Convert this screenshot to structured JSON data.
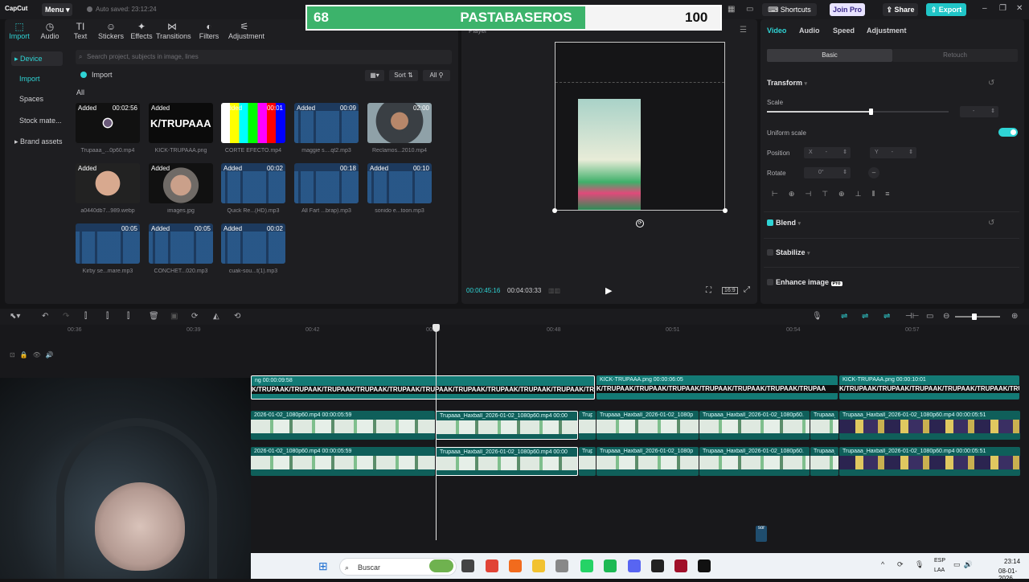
{
  "app": {
    "logo": "CapCut",
    "menu_label": "Menu",
    "autosave": "Auto saved: 23:12:24"
  },
  "topbar": {
    "shortcuts": "Shortcuts",
    "join_pro": "Join Pro",
    "share": "Share",
    "export": "Export"
  },
  "scoreboard": {
    "left_score": "68",
    "title": "PASTABASEROS",
    "right_score": "100"
  },
  "toolbar_tabs": [
    {
      "label": "Import",
      "icon": "import-icon"
    },
    {
      "label": "Audio",
      "icon": "audio-icon"
    },
    {
      "label": "Text",
      "icon": "text-icon"
    },
    {
      "label": "Stickers",
      "icon": "stickers-icon"
    },
    {
      "label": "Effects",
      "icon": "effects-icon"
    },
    {
      "label": "Transitions",
      "icon": "transitions-icon"
    },
    {
      "label": "Filters",
      "icon": "filters-icon"
    },
    {
      "label": "Adjustment",
      "icon": "adjustment-icon"
    }
  ],
  "sidebar": {
    "items": [
      "Device",
      "Import",
      "Spaces",
      "Stock mate...",
      "Brand assets"
    ]
  },
  "media": {
    "search_placeholder": "Search project, subjects in image, lines",
    "import_label": "Import",
    "all_label": "All",
    "sort_label": "Sort",
    "filter_label": "All",
    "items": [
      {
        "tag": "Added",
        "dur": "00:02:56",
        "name": "Trupaaa_...0p60.mp4",
        "kind": "video-dark"
      },
      {
        "tag": "Added",
        "dur": "",
        "name": "KICK-TRUPAAA.png",
        "kind": "logo"
      },
      {
        "tag": "Added",
        "dur": "00:01",
        "name": "CORTE EFECTO.mp4",
        "kind": "bars"
      },
      {
        "tag": "Added",
        "dur": "00:09",
        "name": "maggie s....qt2.mp3",
        "kind": "audio"
      },
      {
        "tag": "",
        "dur": "02:00",
        "name": "Reclamos...2010.mp4",
        "kind": "face"
      },
      {
        "tag": "Added",
        "dur": "",
        "name": "a0440db7...989.webp",
        "kind": "face2"
      },
      {
        "tag": "Added",
        "dur": "",
        "name": "images.jpg",
        "kind": "face3"
      },
      {
        "tag": "Added",
        "dur": "00:02",
        "name": "Quick Re...(HD).mp3",
        "kind": "audio"
      },
      {
        "tag": "",
        "dur": "00:18",
        "name": "All Fart ...brap).mp3",
        "kind": "audio"
      },
      {
        "tag": "Added",
        "dur": "00:10",
        "name": "sonido e...toon.mp3",
        "kind": "audio"
      },
      {
        "tag": "",
        "dur": "00:05",
        "name": "Kirby se...mare.mp3",
        "kind": "audio"
      },
      {
        "tag": "Added",
        "dur": "00:05",
        "name": "CONCHET...020.mp3",
        "kind": "audio"
      },
      {
        "tag": "Added",
        "dur": "00:02",
        "name": "cuak-sou...t(1).mp3",
        "kind": "audio"
      }
    ]
  },
  "player": {
    "label": "Player",
    "current_time": "00:00:45:16",
    "total_time": "00:04:03:33"
  },
  "properties": {
    "tabs": [
      "Video",
      "Audio",
      "Speed",
      "Adjustment"
    ],
    "seg_basic": "Basic",
    "seg_retouch": "Retouch",
    "transform": "Transform",
    "scale": "Scale",
    "scale_value": "-",
    "scale_level": 0.57,
    "uniform_scale": "Uniform scale",
    "position": "Position",
    "pos_x_label": "X",
    "pos_x_value": "-",
    "pos_y_label": "Y",
    "pos_y_value": "-",
    "rotate": "Rotate",
    "rotate_value": "0°",
    "blend": "Blend",
    "stabilize": "Stabilize",
    "enhance": "Enhance image",
    "enhance_badge": "Pro"
  },
  "timeline": {
    "ruler": [
      "00:36",
      "00:39",
      "00:42",
      "00:45",
      "00:48",
      "00:51",
      "00:54",
      "00:57"
    ],
    "text_track": [
      {
        "label": "ng  00:00:09:58",
        "body": "K/TRUPAAK/TRUPAAK/TRUPAAK/TRUPAAK/TRUPAAK/TRUPAAK/TRUPAAK/TRUPAAK/TRUPAAK/TRUPAAK/TRUPAAK/TRUPAA"
      },
      {
        "label": "KICK-TRUPAAA.png  00:00:06:05",
        "body": "K/TRUPAAK/TRUPAAK/TRUPAAK/TRUPAAK/TRUPAAK/TRUPAAK/TRUPAA"
      },
      {
        "label": "KICK-TRUPAAA.png  00:00:10:01",
        "body": "K/TRUPAAK/TRUPAAK/TRUPAAK/TRUPAAK/TRUPAAK/TRUPAA"
      }
    ],
    "video_track_1": [
      {
        "label": "2026-01-02_1080p60.mp4  00:00:05:59"
      },
      {
        "label": "Trupaaa_Haxball_2026-01-02_1080p60.mp4  00:00"
      },
      {
        "label": "Trupa"
      },
      {
        "label": "Trupaaa_Haxball_2026-01-02_1080p"
      },
      {
        "label": "Trupaaa_Haxball_2026-01-02_1080p60."
      },
      {
        "label": "Trupaaa_H"
      },
      {
        "label": "Trupaaa_Haxball_2026-01-02_1080p60.mp4  00:00:05:51"
      }
    ],
    "video_track_2": [
      {
        "label": "2026-01-02_1080p60.mp4  00:00:05:59"
      },
      {
        "label": "Trupaaa_Haxball_2026-01-02_1080p60.mp4  00:00"
      },
      {
        "label": "Trupa"
      },
      {
        "label": "Trupaaa_Haxball_2026-01-02_1080p"
      },
      {
        "label": "Trupaaa_Haxball_2026-01-02_1080p60."
      },
      {
        "label": "Trupaaa_H"
      },
      {
        "label": "Trupaaa_Haxball_2026-01-02_1080p60.mp4  00:00:05:51"
      }
    ]
  },
  "taskbar": {
    "search": "Buscar",
    "lang1": "ESP",
    "lang2": "LAA",
    "time": "23:14",
    "date": "08-01-2026"
  },
  "colors": {
    "accent": "#2fd4d5",
    "score_green": "#3cb36b"
  }
}
